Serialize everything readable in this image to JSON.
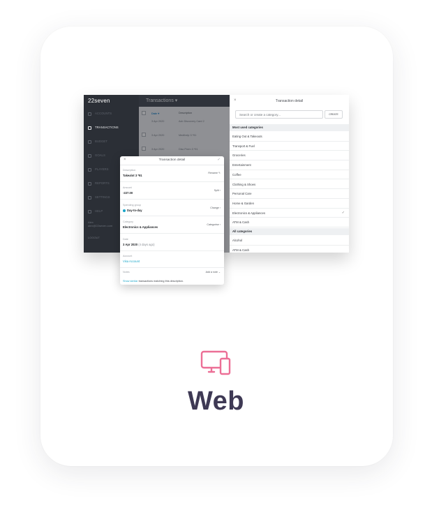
{
  "mockup": {
    "sidebar": {
      "logo": "22seven",
      "items": [
        {
          "label": "ACCOUNTS",
          "active": false
        },
        {
          "label": "TRANSACTIONS",
          "active": true
        },
        {
          "label": "BUDGET",
          "active": false
        },
        {
          "label": "GOALS",
          "active": false
        },
        {
          "label": "PLAYERS",
          "active": false
        },
        {
          "label": "REPORTS",
          "active": false
        },
        {
          "label": "SETTINGS",
          "active": false
        },
        {
          "label": "HELP",
          "active": false
        }
      ],
      "user_name": "Alex",
      "user_email": "alex@22seven.com",
      "logout": "LOGOUT"
    },
    "transactions": {
      "title": "Transactions",
      "date_header": "Date",
      "description_header": "Description",
      "rows": [
        {
          "date": "3 Apr 2020",
          "description": "Acb Discovery Card 2"
        },
        {
          "date": "3 Apr 2020",
          "description": "Medihelp 3 *91"
        },
        {
          "date": "3 Apr 2020",
          "description": "Disc Prem 3 *91"
        }
      ]
    },
    "category_panel": {
      "close": "×",
      "title": "Transaction detail",
      "search_placeholder": "Search or create a category...",
      "create_label": "CREATE",
      "most_used_title": "Most used categories",
      "most_used": [
        "Eating Out & Takeouts",
        "Transport & Fuel",
        "Groceries",
        "Entertainment",
        "Coffee",
        "Clothing & Shoes",
        "Personal Care",
        "Home & Garden",
        "Electronics & Appliances",
        "ATM & Cash"
      ],
      "selected": "Electronics & Appliances",
      "all_title": "All categories",
      "all": [
        "Alcohol",
        "ATM & Cash"
      ]
    },
    "detail": {
      "close": "×",
      "title": "Transaction detail",
      "fields": {
        "description": {
          "label": "Description",
          "value": "Takealot 3 *91",
          "action": "Rename"
        },
        "amount": {
          "label": "Amount",
          "value": "-227.00",
          "action": "Split"
        },
        "spending": {
          "label": "Spending group",
          "value": "Day-to-day",
          "action": "Change"
        },
        "category": {
          "label": "Category",
          "value": "Electronics & Appliances",
          "action": "Categorise"
        },
        "date": {
          "label": "Date",
          "value": "3 Apr 2020",
          "hint": "(4 days ago)"
        },
        "account": {
          "label": "Account",
          "value": "Visa Account"
        },
        "notes": {
          "label": "Notes",
          "action": "Add a note"
        }
      },
      "footer_link": "Show similar",
      "footer_text": "transactions matching this description."
    }
  },
  "platform": {
    "label": "Web",
    "icon": "devices-icon",
    "accent": "#ec6f96",
    "text_color": "#3e3954"
  }
}
